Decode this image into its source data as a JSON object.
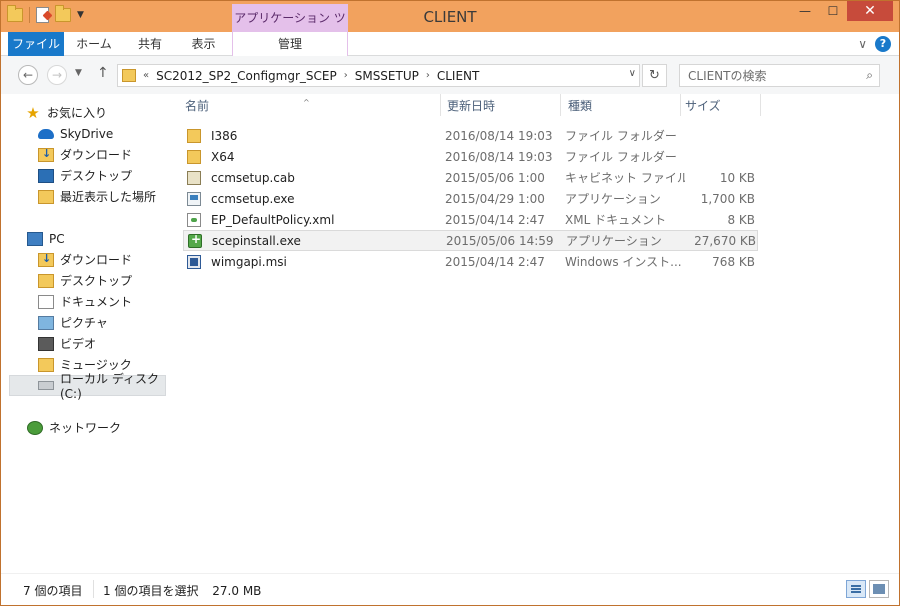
{
  "window": {
    "title": "CLIENT"
  },
  "ribbon": {
    "context_group": "アプリケーション ツール",
    "tabs": {
      "file": "ファイル",
      "home": "ホーム",
      "share": "共有",
      "view": "表示",
      "manage": "管理"
    },
    "help": "?"
  },
  "address": {
    "overflow": "«",
    "crumbs": [
      "SC2012_SP2_Configmgr_SCEP",
      "SMSSETUP",
      "CLIENT"
    ],
    "separator": "›"
  },
  "search": {
    "placeholder": "CLIENTの検索"
  },
  "navpane": {
    "favorites": {
      "label": "お気に入り",
      "items": [
        "SkyDrive",
        "ダウンロード",
        "デスクトップ",
        "最近表示した場所"
      ]
    },
    "pc": {
      "label": "PC",
      "items": [
        "ダウンロード",
        "デスクトップ",
        "ドキュメント",
        "ピクチャ",
        "ビデオ",
        "ミュージック",
        "ローカル ディスク (C:)"
      ]
    },
    "network": {
      "label": "ネットワーク"
    }
  },
  "filelist": {
    "columns": {
      "name": "名前",
      "date": "更新日時",
      "type": "種類",
      "size": "サイズ"
    },
    "rows": [
      {
        "name": "I386",
        "date": "2016/08/14 19:03",
        "type": "ファイル フォルダー",
        "size": "",
        "icon": "folder-icon"
      },
      {
        "name": "X64",
        "date": "2016/08/14 19:03",
        "type": "ファイル フォルダー",
        "size": "",
        "icon": "folder-icon"
      },
      {
        "name": "ccmsetup.cab",
        "date": "2015/05/06 1:00",
        "type": "キャビネット ファイル",
        "size": "10 KB",
        "icon": "cab-file-icon"
      },
      {
        "name": "ccmsetup.exe",
        "date": "2015/04/29 1:00",
        "type": "アプリケーション",
        "size": "1,700 KB",
        "icon": "exe-file-icon"
      },
      {
        "name": "EP_DefaultPolicy.xml",
        "date": "2015/04/14 2:47",
        "type": "XML ドキュメント",
        "size": "8 KB",
        "icon": "xml-file-icon"
      },
      {
        "name": "scepinstall.exe",
        "date": "2015/05/06 14:59",
        "type": "アプリケーション",
        "size": "27,670 KB",
        "icon": "scep-installer-icon"
      },
      {
        "name": "wimgapi.msi",
        "date": "2015/04/14 2:47",
        "type": "Windows インスト...",
        "size": "768 KB",
        "icon": "msi-file-icon"
      }
    ]
  },
  "status": {
    "count": "7 個の項目",
    "selection": "1 個の項目を選択",
    "selection_size": "27.0 MB"
  }
}
